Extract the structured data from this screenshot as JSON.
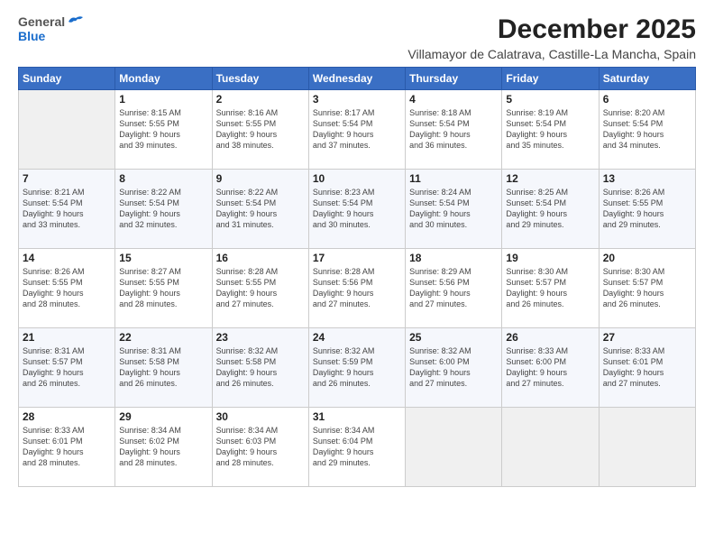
{
  "logo": {
    "general": "General",
    "blue": "Blue"
  },
  "title": "December 2025",
  "subtitle": "Villamayor de Calatrava, Castille-La Mancha, Spain",
  "headers": [
    "Sunday",
    "Monday",
    "Tuesday",
    "Wednesday",
    "Thursday",
    "Friday",
    "Saturday"
  ],
  "weeks": [
    [
      {
        "day": "",
        "info": ""
      },
      {
        "day": "1",
        "info": "Sunrise: 8:15 AM\nSunset: 5:55 PM\nDaylight: 9 hours\nand 39 minutes."
      },
      {
        "day": "2",
        "info": "Sunrise: 8:16 AM\nSunset: 5:55 PM\nDaylight: 9 hours\nand 38 minutes."
      },
      {
        "day": "3",
        "info": "Sunrise: 8:17 AM\nSunset: 5:54 PM\nDaylight: 9 hours\nand 37 minutes."
      },
      {
        "day": "4",
        "info": "Sunrise: 8:18 AM\nSunset: 5:54 PM\nDaylight: 9 hours\nand 36 minutes."
      },
      {
        "day": "5",
        "info": "Sunrise: 8:19 AM\nSunset: 5:54 PM\nDaylight: 9 hours\nand 35 minutes."
      },
      {
        "day": "6",
        "info": "Sunrise: 8:20 AM\nSunset: 5:54 PM\nDaylight: 9 hours\nand 34 minutes."
      }
    ],
    [
      {
        "day": "7",
        "info": "Sunrise: 8:21 AM\nSunset: 5:54 PM\nDaylight: 9 hours\nand 33 minutes."
      },
      {
        "day": "8",
        "info": "Sunrise: 8:22 AM\nSunset: 5:54 PM\nDaylight: 9 hours\nand 32 minutes."
      },
      {
        "day": "9",
        "info": "Sunrise: 8:22 AM\nSunset: 5:54 PM\nDaylight: 9 hours\nand 31 minutes."
      },
      {
        "day": "10",
        "info": "Sunrise: 8:23 AM\nSunset: 5:54 PM\nDaylight: 9 hours\nand 30 minutes."
      },
      {
        "day": "11",
        "info": "Sunrise: 8:24 AM\nSunset: 5:54 PM\nDaylight: 9 hours\nand 30 minutes."
      },
      {
        "day": "12",
        "info": "Sunrise: 8:25 AM\nSunset: 5:54 PM\nDaylight: 9 hours\nand 29 minutes."
      },
      {
        "day": "13",
        "info": "Sunrise: 8:26 AM\nSunset: 5:55 PM\nDaylight: 9 hours\nand 29 minutes."
      }
    ],
    [
      {
        "day": "14",
        "info": "Sunrise: 8:26 AM\nSunset: 5:55 PM\nDaylight: 9 hours\nand 28 minutes."
      },
      {
        "day": "15",
        "info": "Sunrise: 8:27 AM\nSunset: 5:55 PM\nDaylight: 9 hours\nand 28 minutes."
      },
      {
        "day": "16",
        "info": "Sunrise: 8:28 AM\nSunset: 5:55 PM\nDaylight: 9 hours\nand 27 minutes."
      },
      {
        "day": "17",
        "info": "Sunrise: 8:28 AM\nSunset: 5:56 PM\nDaylight: 9 hours\nand 27 minutes."
      },
      {
        "day": "18",
        "info": "Sunrise: 8:29 AM\nSunset: 5:56 PM\nDaylight: 9 hours\nand 27 minutes."
      },
      {
        "day": "19",
        "info": "Sunrise: 8:30 AM\nSunset: 5:57 PM\nDaylight: 9 hours\nand 26 minutes."
      },
      {
        "day": "20",
        "info": "Sunrise: 8:30 AM\nSunset: 5:57 PM\nDaylight: 9 hours\nand 26 minutes."
      }
    ],
    [
      {
        "day": "21",
        "info": "Sunrise: 8:31 AM\nSunset: 5:57 PM\nDaylight: 9 hours\nand 26 minutes."
      },
      {
        "day": "22",
        "info": "Sunrise: 8:31 AM\nSunset: 5:58 PM\nDaylight: 9 hours\nand 26 minutes."
      },
      {
        "day": "23",
        "info": "Sunrise: 8:32 AM\nSunset: 5:58 PM\nDaylight: 9 hours\nand 26 minutes."
      },
      {
        "day": "24",
        "info": "Sunrise: 8:32 AM\nSunset: 5:59 PM\nDaylight: 9 hours\nand 26 minutes."
      },
      {
        "day": "25",
        "info": "Sunrise: 8:32 AM\nSunset: 6:00 PM\nDaylight: 9 hours\nand 27 minutes."
      },
      {
        "day": "26",
        "info": "Sunrise: 8:33 AM\nSunset: 6:00 PM\nDaylight: 9 hours\nand 27 minutes."
      },
      {
        "day": "27",
        "info": "Sunrise: 8:33 AM\nSunset: 6:01 PM\nDaylight: 9 hours\nand 27 minutes."
      }
    ],
    [
      {
        "day": "28",
        "info": "Sunrise: 8:33 AM\nSunset: 6:01 PM\nDaylight: 9 hours\nand 28 minutes."
      },
      {
        "day": "29",
        "info": "Sunrise: 8:34 AM\nSunset: 6:02 PM\nDaylight: 9 hours\nand 28 minutes."
      },
      {
        "day": "30",
        "info": "Sunrise: 8:34 AM\nSunset: 6:03 PM\nDaylight: 9 hours\nand 28 minutes."
      },
      {
        "day": "31",
        "info": "Sunrise: 8:34 AM\nSunset: 6:04 PM\nDaylight: 9 hours\nand 29 minutes."
      },
      {
        "day": "",
        "info": ""
      },
      {
        "day": "",
        "info": ""
      },
      {
        "day": "",
        "info": ""
      }
    ]
  ]
}
